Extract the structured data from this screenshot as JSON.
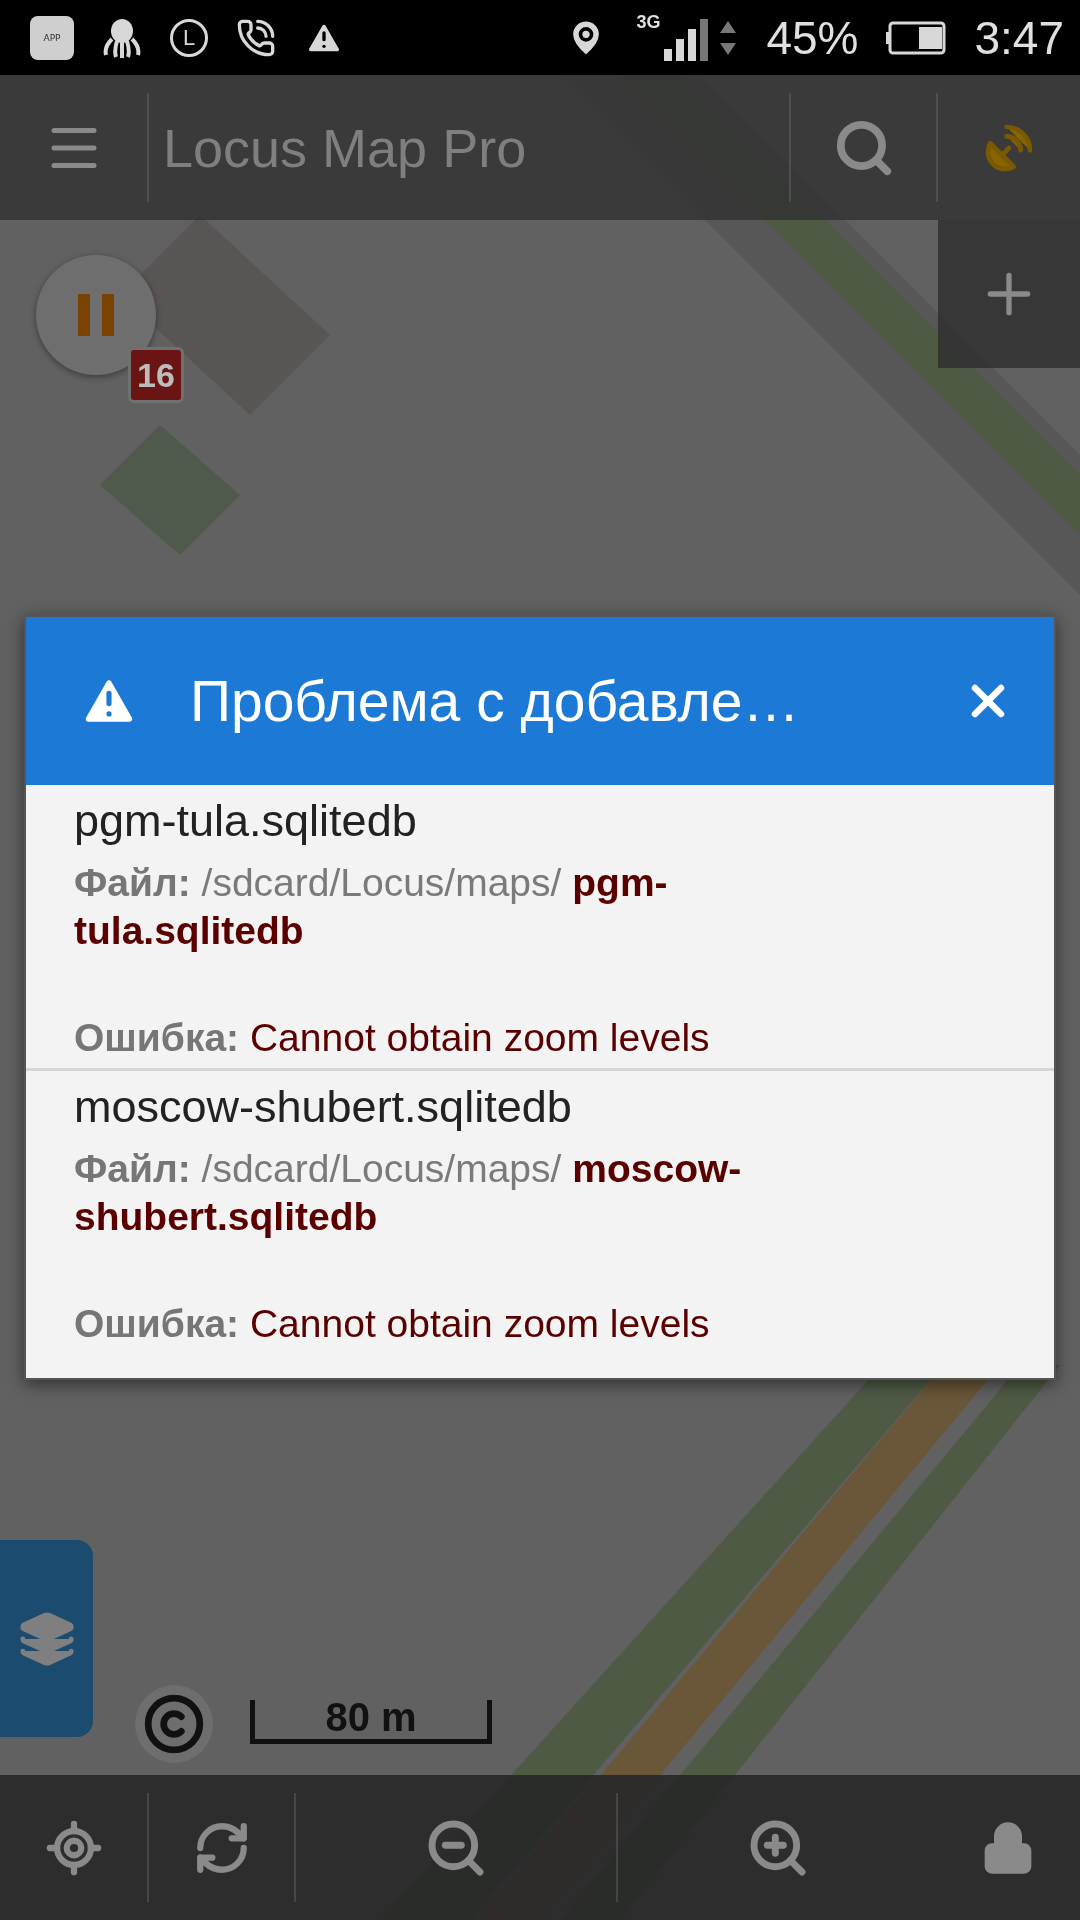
{
  "status_bar": {
    "app_label": "APP",
    "l_label": "L",
    "network": "3G",
    "battery": "45%",
    "time": "3:47"
  },
  "toolbar": {
    "title": "Locus Map Pro"
  },
  "track_recording": {
    "badge": "16"
  },
  "scale_bar": {
    "label": "80 m"
  },
  "dialog": {
    "title": "Проблема с добавле…",
    "items": [
      {
        "name": "pgm-tula.sqlitedb",
        "file_label": "Файл:",
        "path": "/sdcard/Locus/maps/",
        "file": "pgm-tula.sqlitedb",
        "error_label": "Ошибка:",
        "error": "Cannot obtain zoom levels"
      },
      {
        "name": "moscow-shubert.sqlitedb",
        "file_label": "Файл:",
        "path": "/sdcard/Locus/maps/",
        "file": "moscow-shubert.sqlitedb",
        "error_label": "Ошибка:",
        "error": "Cannot obtain zoom levels"
      }
    ]
  }
}
